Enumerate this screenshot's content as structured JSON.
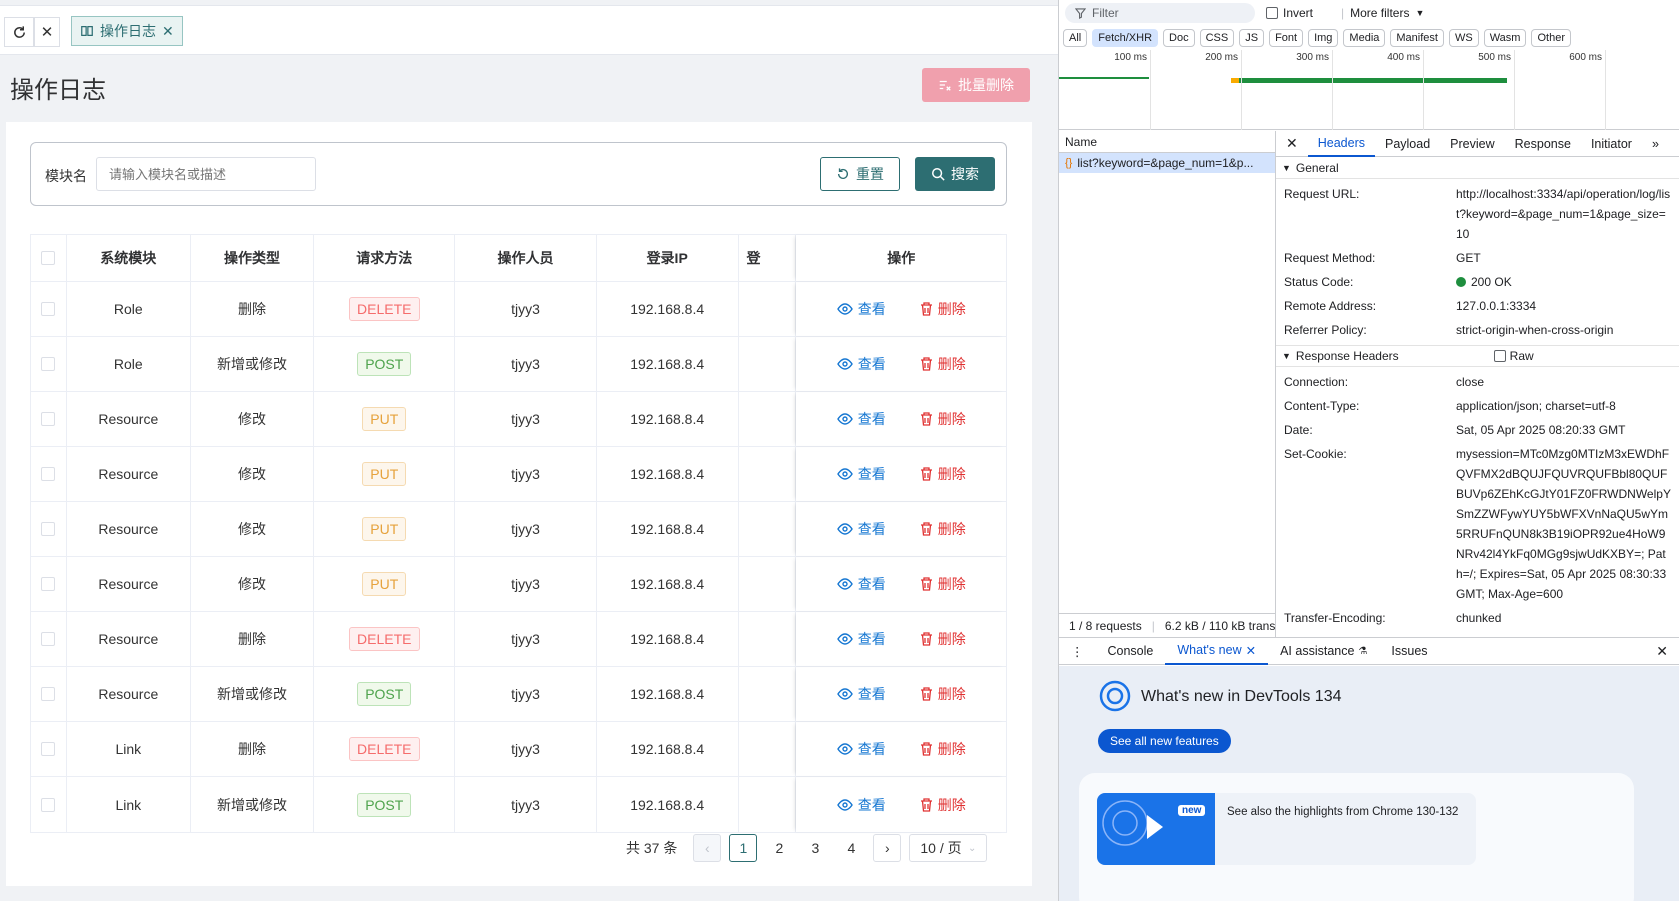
{
  "app": {
    "tab_label": "操作日志",
    "page_title": "操作日志",
    "batch_delete": "批量删除",
    "search": {
      "label": "模块名",
      "placeholder": "请输入模块名或描述",
      "reset": "重置",
      "submit": "搜索"
    },
    "columns": [
      "系统模块",
      "操作类型",
      "请求方法",
      "操作人员",
      "登录IP",
      "登",
      "操作"
    ],
    "rows": [
      {
        "module": "Role",
        "type": "删除",
        "method": "DELETE",
        "user": "tjyy3",
        "ip": "192.168.8.4"
      },
      {
        "module": "Role",
        "type": "新增或修改",
        "method": "POST",
        "user": "tjyy3",
        "ip": "192.168.8.4"
      },
      {
        "module": "Resource",
        "type": "修改",
        "method": "PUT",
        "user": "tjyy3",
        "ip": "192.168.8.4"
      },
      {
        "module": "Resource",
        "type": "修改",
        "method": "PUT",
        "user": "tjyy3",
        "ip": "192.168.8.4"
      },
      {
        "module": "Resource",
        "type": "修改",
        "method": "PUT",
        "user": "tjyy3",
        "ip": "192.168.8.4"
      },
      {
        "module": "Resource",
        "type": "修改",
        "method": "PUT",
        "user": "tjyy3",
        "ip": "192.168.8.4"
      },
      {
        "module": "Resource",
        "type": "删除",
        "method": "DELETE",
        "user": "tjyy3",
        "ip": "192.168.8.4"
      },
      {
        "module": "Resource",
        "type": "新增或修改",
        "method": "POST",
        "user": "tjyy3",
        "ip": "192.168.8.4"
      },
      {
        "module": "Link",
        "type": "删除",
        "method": "DELETE",
        "user": "tjyy3",
        "ip": "192.168.8.4"
      },
      {
        "module": "Link",
        "type": "新增或修改",
        "method": "POST",
        "user": "tjyy3",
        "ip": "192.168.8.4"
      }
    ],
    "actions": {
      "view": "查看",
      "delete": "删除"
    },
    "pagination": {
      "total": "共 37 条",
      "pages": [
        "1",
        "2",
        "3",
        "4"
      ],
      "current": "1",
      "page_size": "10 / 页"
    },
    "colors": {
      "primary": "#2d6e72",
      "danger": "#e03131",
      "link": "#1677d2"
    }
  },
  "devtools": {
    "filter_placeholder": "Filter",
    "invert": "Invert",
    "more_filters": "More filters",
    "types": [
      "All",
      "Fetch/XHR",
      "Doc",
      "CSS",
      "JS",
      "Font",
      "Img",
      "Media",
      "Manifest",
      "WS",
      "Wasm",
      "Other"
    ],
    "active_type": "Fetch/XHR",
    "ticks": [
      "100 ms",
      "200 ms",
      "300 ms",
      "400 ms",
      "500 ms",
      "600 ms"
    ],
    "name_header": "Name",
    "request": "list?keyword=&page_num=1&p...",
    "summary": {
      "requests": "1 / 8 requests",
      "transfer": "6.2 kB / 110 kB trans"
    },
    "detail_tabs": [
      "Headers",
      "Payload",
      "Preview",
      "Response",
      "Initiator"
    ],
    "general": {
      "title": "General",
      "items": [
        {
          "k": "Request URL:",
          "v": "http://localhost:3334/api/operation/log/list?keyword=&page_num=1&page_size=10"
        },
        {
          "k": "Request Method:",
          "v": "GET"
        },
        {
          "k": "Status Code:",
          "v": "200 OK"
        },
        {
          "k": "Remote Address:",
          "v": "127.0.0.1:3334"
        },
        {
          "k": "Referrer Policy:",
          "v": "strict-origin-when-cross-origin"
        }
      ]
    },
    "response_headers": {
      "title": "Response Headers",
      "raw": "Raw",
      "items": [
        {
          "k": "Connection:",
          "v": "close"
        },
        {
          "k": "Content-Type:",
          "v": "application/json; charset=utf-8"
        },
        {
          "k": "Date:",
          "v": "Sat, 05 Apr 2025 08:20:33 GMT"
        },
        {
          "k": "Set-Cookie:",
          "v": "mysession=MTc0Mzg0MTIzM3xEWDhFQVFMX2dBQUJFQUVRQUFBbl80QUFBUVp6ZEhKcGJtY01FZ0FRWDNWelpYSmZZWFywYUY5bWFXVnNaQU5wYm5RRUFnQUN8k3B19iOPR92ue4HoW9NRv42l4YkFq0MGg9sjwUdKXBY=; Path=/; Expires=Sat, 05 Apr 2025 08:30:33 GMT; Max-Age=600"
        },
        {
          "k": "Transfer-Encoding:",
          "v": "chunked"
        }
      ]
    },
    "drawer_tabs": [
      "Console",
      "What's new",
      "AI assistance",
      "Issues"
    ],
    "whats_new": {
      "title": "What's new in DevTools 134",
      "button": "See all new features",
      "badge": "new",
      "highlight": "See also the highlights from Chrome 130-132"
    }
  }
}
